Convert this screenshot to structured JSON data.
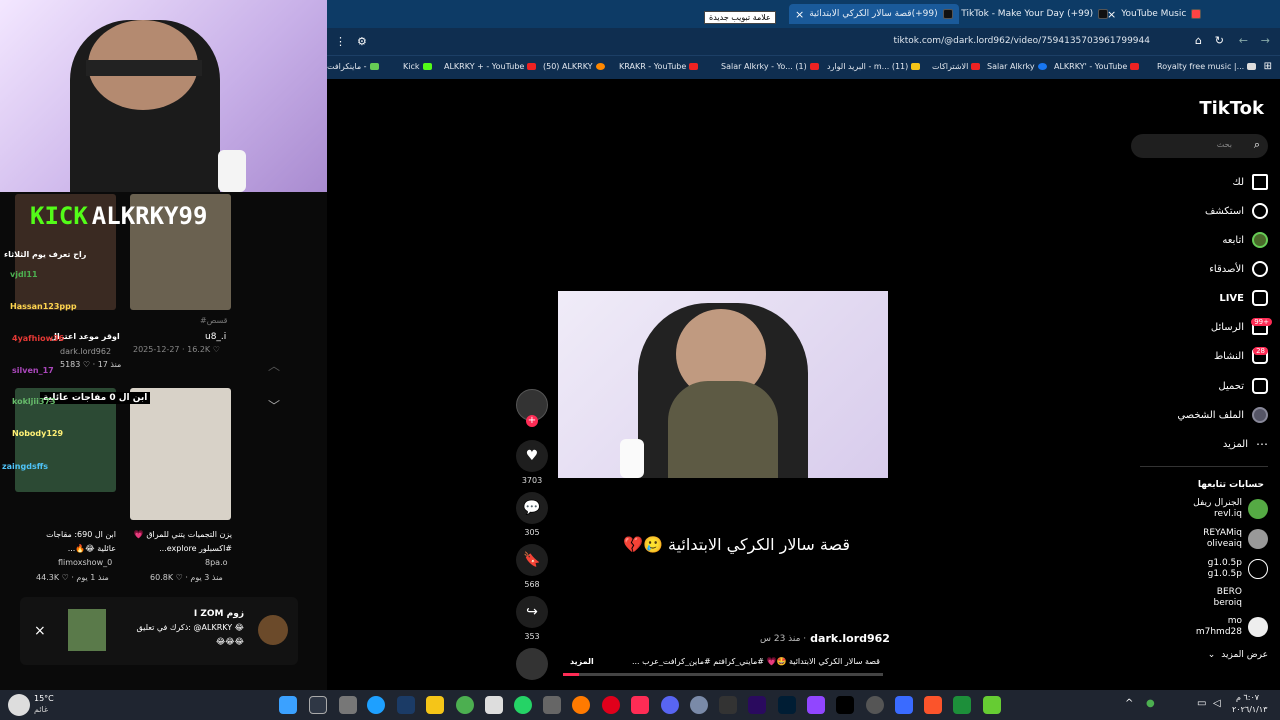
{
  "tabs": [
    {
      "label": "YouTube Music"
    },
    {
      "label": "(99+) TikTok - Make Your Day"
    },
    {
      "label": "(99+)قصة سالار الكركي الابتدائية"
    }
  ],
  "tooltip": "علامة تبويب جديدة",
  "url": "tiktok.com/@dark.lord962/video/7594135703961799944",
  "bookmarks": [
    "Royalty free music |...",
    "ALKRKY' - YouTube",
    "Salar Alkrky",
    "الاشتراكات",
    "البريد الوارد - m... (11)",
    "Salar Alkrky - Yo... (1)",
    "KRAKR - YouTube",
    "(50) ALKRKY",
    "ALKRKY + - YouTube",
    "Kick",
    "ماينكرافت -"
  ],
  "overlay": {
    "brand": "KICK",
    "channel": "ALKRKY99"
  },
  "chat": [
    {
      "user": "vjdl11",
      "color": "#4caf50"
    },
    {
      "user": "Hassan123ppp",
      "color": "#ffd54f"
    },
    {
      "user": "4yafhiow36",
      "color": "#e53935"
    },
    {
      "user": "silven_17",
      "color": "#ab47bc"
    },
    {
      "user": "kokljii373",
      "color": "#66bb6a"
    },
    {
      "user": "Nobody129",
      "color": "#fff176"
    },
    {
      "user": "zaingdsffs",
      "color": "#4fc3f7"
    }
  ],
  "chat_msgs": [
    "راح تعرف يوم الثلاثاء",
    "اوقر موعد اعتزال"
  ],
  "grid": [
    {
      "title": "u8_.i",
      "user": "#قسص",
      "date": "2025-12-27 · 16.2K ♡"
    },
    {
      "title": "dark.lord962",
      "views": "5183 ♡ · منذ 17"
    },
    {
      "title": "يزن التجميات يتني للمراق 💗#اكسبلور explore...",
      "user": "8pa.o",
      "stats": "60.8K ♡ · منذ 3 يوم"
    },
    {
      "title": "ابن ال 690: مقاجات عائلية 😂🔥...",
      "user": "flimoxshow_0",
      "stats": "44.3K ♡ · منذ 1 يوم"
    }
  ],
  "thumb_text": "ابن ال 0 مفاجات عائلية",
  "notification": {
    "name": "I ZOM زوم",
    "text": "ذكرك في تعليق: @ALKRKY 😂",
    "emoji": "😂😂😂"
  },
  "tiktok": {
    "logo": "TikTok",
    "search_placeholder": "بحث"
  },
  "nav": [
    {
      "label": "لك"
    },
    {
      "label": "استكشف"
    },
    {
      "label": "اتابعه"
    },
    {
      "label": "الأصدقاء"
    },
    {
      "label": "LIVE"
    },
    {
      "label": "الرسائل",
      "badge": "99+"
    },
    {
      "label": "النشاط",
      "badge": "28"
    },
    {
      "label": "تحميل"
    },
    {
      "label": "الملف الشخصي"
    },
    {
      "label": "المزيد"
    }
  ],
  "following_title": "حسابات تتابعها",
  "accounts": [
    {
      "name": "الجنرال ريفل",
      "handle": "revl.iq"
    },
    {
      "name": "REYAMiq",
      "handle": "oliveaiq"
    },
    {
      "name": "g1.0.5p",
      "handle": "g1.0.5p"
    },
    {
      "name": "BERO",
      "handle": "beroiq"
    },
    {
      "name": "mo",
      "handle": "m7hmd28"
    }
  ],
  "see_more": "عرض المزيد",
  "video": {
    "caption": "قصة سالار الكركي الابتدائية 🥲💔",
    "author": "dark.lord962",
    "time": "· منذ 23 س",
    "desc": "قصة سالار الكركي الابتدائية 🤩💗 #مايني_كرافتم #ماين_كرافت_عرب ...",
    "more": "المزيد"
  },
  "actions": [
    {
      "icon": "♥",
      "count": "3703"
    },
    {
      "icon": "💬",
      "count": "305"
    },
    {
      "icon": "🔖",
      "count": "568"
    },
    {
      "icon": "↪",
      "count": "353"
    }
  ],
  "weather": {
    "temp": "15°C",
    "desc": "غائم"
  },
  "clock": {
    "time": "٦:٠٧ م",
    "date": "٢٠٢٦/١/١٣"
  }
}
